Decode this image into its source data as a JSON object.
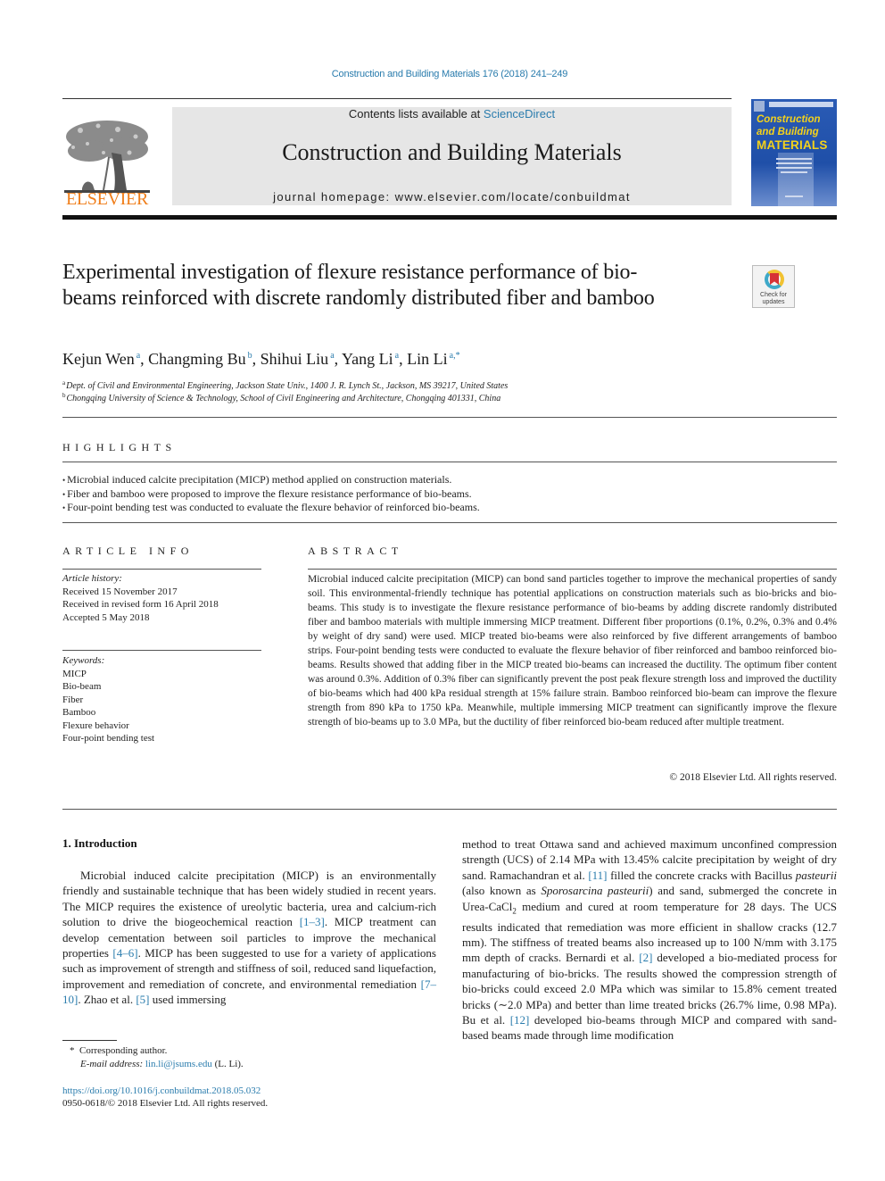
{
  "header": {
    "journal_ref": "Construction and Building Materials 176 (2018) 241–249",
    "contents_prefix": "Contents lists available at ",
    "contents_link": "ScienceDirect",
    "journal_name": "Construction and Building Materials",
    "homepage": "journal homepage: www.elsevier.com/locate/conbuildmat",
    "publisher_logo_text": "ELSEVIER",
    "cover": {
      "line1": "Construction",
      "line2": "and Building",
      "line3": "MATERIALS"
    },
    "colors": {
      "link": "#2a7cad",
      "elsevier_orange": "#f07e1a",
      "cover_blue": "#1f4fa8",
      "cover_yellow": "#f5d21a"
    }
  },
  "article": {
    "title": "Experimental investigation of flexure resistance performance of bio-beams reinforced with discrete randomly distributed fiber and bamboo",
    "check_updates": {
      "line1": "Check for",
      "line2": "updates"
    },
    "authors": [
      {
        "name": "Kejun Wen",
        "sup": "a"
      },
      {
        "name": "Changming Bu",
        "sup": "b"
      },
      {
        "name": "Shihui Liu",
        "sup": "a"
      },
      {
        "name": "Yang Li",
        "sup": "a"
      },
      {
        "name": "Lin Li",
        "sup": "a,*"
      }
    ],
    "affiliations": [
      {
        "sup": "a",
        "text": "Dept. of Civil and Environmental Engineering, Jackson State Univ., 1400 J. R. Lynch St., Jackson, MS 39217, United States"
      },
      {
        "sup": "b",
        "text": "Chongqing University of Science & Technology, School of Civil Engineering and Architecture, Chongqing 401331, China"
      }
    ]
  },
  "highlights": {
    "heading": "HIGHLIGHTS",
    "items": [
      "Microbial induced calcite precipitation (MICP) method applied on construction materials.",
      "Fiber and bamboo were proposed to improve the flexure resistance performance of bio-beams.",
      "Four-point bending test was conducted to evaluate the flexure behavior of reinforced bio-beams."
    ]
  },
  "article_info": {
    "heading": "ARTICLE INFO",
    "history_label": "Article history:",
    "history": [
      "Received 15 November 2017",
      "Received in revised form 16 April 2018",
      "Accepted 5 May 2018"
    ],
    "keywords_label": "Keywords:",
    "keywords": [
      "MICP",
      "Bio-beam",
      "Fiber",
      "Bamboo",
      "Flexure behavior",
      "Four-point bending test"
    ]
  },
  "abstract": {
    "heading": "ABSTRACT",
    "text": "Microbial induced calcite precipitation (MICP) can bond sand particles together to improve the mechanical properties of sandy soil. This environmental-friendly technique has potential applications on construction materials such as bio-bricks and bio-beams. This study is to investigate the flexure resistance performance of bio-beams by adding discrete randomly distributed fiber and bamboo materials with multiple immersing MICP treatment. Different fiber proportions (0.1%, 0.2%, 0.3% and 0.4% by weight of dry sand) were used. MICP treated bio-beams were also reinforced by five different arrangements of bamboo strips. Four-point bending tests were conducted to evaluate the flexure behavior of fiber reinforced and bamboo reinforced bio-beams. Results showed that adding fiber in the MICP treated bio-beams can increased the ductility. The optimum fiber content was around 0.3%. Addition of 0.3% fiber can significantly prevent the post peak flexure strength loss and improved the ductility of bio-beams which had 400 kPa residual strength at 15% failure strain. Bamboo reinforced bio-beam can improve the flexure strength from 890 kPa to 1750 kPa. Meanwhile, multiple immersing MICP treatment can significantly improve the flexure strength of bio-beams up to 3.0 MPa, but the ductility of fiber reinforced bio-beam reduced after multiple treatment.",
    "copyright": "© 2018 Elsevier Ltd. All rights reserved."
  },
  "introduction": {
    "heading": "1. Introduction",
    "left": [
      {
        "t": "Microbial induced calcite precipitation (MICP) is an environmentally friendly and sustainable technique that has been widely studied in recent years. The MICP requires the existence of ureolytic bacteria, urea and calcium-rich solution to drive the biogeochemical reaction "
      },
      {
        "ref": "[1–3]"
      },
      {
        "t": ". MICP treatment can develop cementation between soil particles to improve the mechanical properties "
      },
      {
        "ref": "[4–6]"
      },
      {
        "t": ". MICP has been suggested to use for a variety of applications such as improvement of strength and stiffness of soil, reduced sand liquefaction, improvement and remediation of concrete, and environmental remediation "
      },
      {
        "ref": "[7–10]"
      },
      {
        "t": ". Zhao et al. "
      },
      {
        "ref": "[5]"
      },
      {
        "t": " used immersing"
      }
    ],
    "right": [
      {
        "t": "method to treat Ottawa sand and achieved maximum unconfined compression strength (UCS) of 2.14 MPa with 13.45% calcite precipitation by weight of dry sand. Ramachandran et al. "
      },
      {
        "ref": "[11]"
      },
      {
        "t": " filled the concrete cracks with Bacillus "
      },
      {
        "i": "pasteurii"
      },
      {
        "t": " (also known as "
      },
      {
        "i": "Sporosarcina pasteurii"
      },
      {
        "t": ") and sand, submerged the concrete in Urea-CaCl"
      },
      {
        "sub": "2"
      },
      {
        "t": " medium and cured at room temperature for 28 days. The UCS results indicated that remediation was more efficient in shallow cracks (12.7 mm). The stiffness of treated beams also increased up to 100 N/mm with 3.175 mm depth of cracks. Bernardi et al. "
      },
      {
        "ref": "[2]"
      },
      {
        "t": " developed a bio-mediated process for manufacturing of bio-bricks. The results showed the compression strength of bio-bricks could exceed 2.0 MPa which was similar to 15.8% cement treated bricks (∼2.0 MPa) and better than lime treated bricks (26.7% lime, 0.98 MPa). Bu et al. "
      },
      {
        "ref": "[12]"
      },
      {
        "t": " developed bio-beams through MICP and compared with sand-based beams made through lime modification"
      }
    ]
  },
  "footnotes": {
    "corresponding_mark": "*",
    "corresponding": "Corresponding author.",
    "email_label": "E-mail address:",
    "email": "lin.li@jsums.edu",
    "email_suffix": " (L. Li).",
    "doi": "https://doi.org/10.1016/j.conbuildmat.2018.05.032",
    "issn": "0950-0618/© 2018 Elsevier Ltd. All rights reserved."
  }
}
